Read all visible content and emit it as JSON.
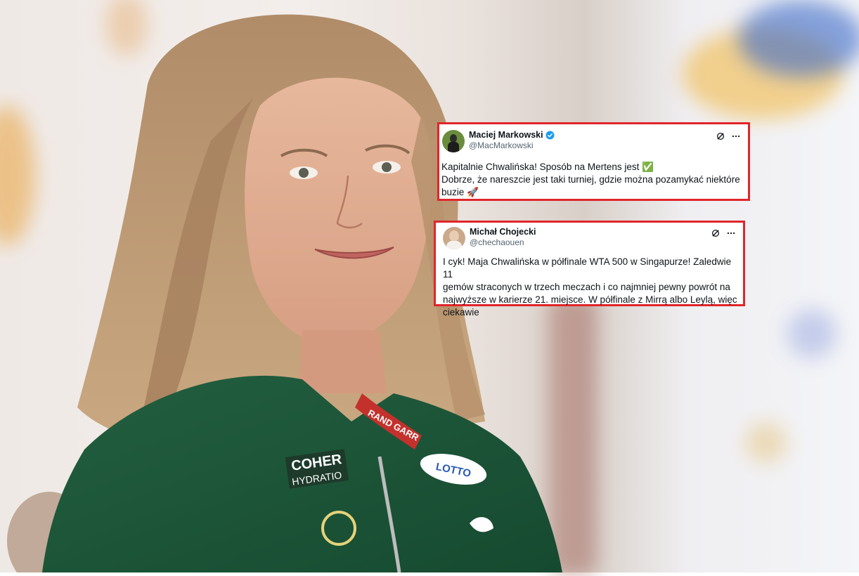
{
  "tweets": [
    {
      "display_name": "Maciej Markowski",
      "handle": "@MacMarkowski",
      "verified": true,
      "line1": "Kapitalnie Chwalińska! Sposób na Mertens jest",
      "line1_emoji": "✅",
      "line2": "Dobrze, że nareszcie jest taki turniej, gdzie można pozamykać niektóre",
      "line3": "buzie",
      "line3_emoji": "🚀"
    },
    {
      "display_name": "Michał Chojecki",
      "handle": "@chechaouen",
      "verified": false,
      "lines": [
        "I cyk! Maja Chwalińska w półfinale WTA 500 w Singapurze! Zaledwie 11",
        "gemów straconych w trzech meczach i co najmniej pewny powrót na",
        "najwyższe w karierze 21. miejsce. W półfinale z Mirrą albo Leylą, więc",
        "ciekawie"
      ]
    }
  ],
  "jacket_texts": {
    "collar": "RAND GARR",
    "sponsor": "COHER",
    "sponsor_sub": "HYDRATIO",
    "lotto": "LOTTO"
  },
  "colors": {
    "highlight_border": "#e0262b",
    "jacket": "#1f5b3b",
    "verified": "#1d9bf0"
  }
}
